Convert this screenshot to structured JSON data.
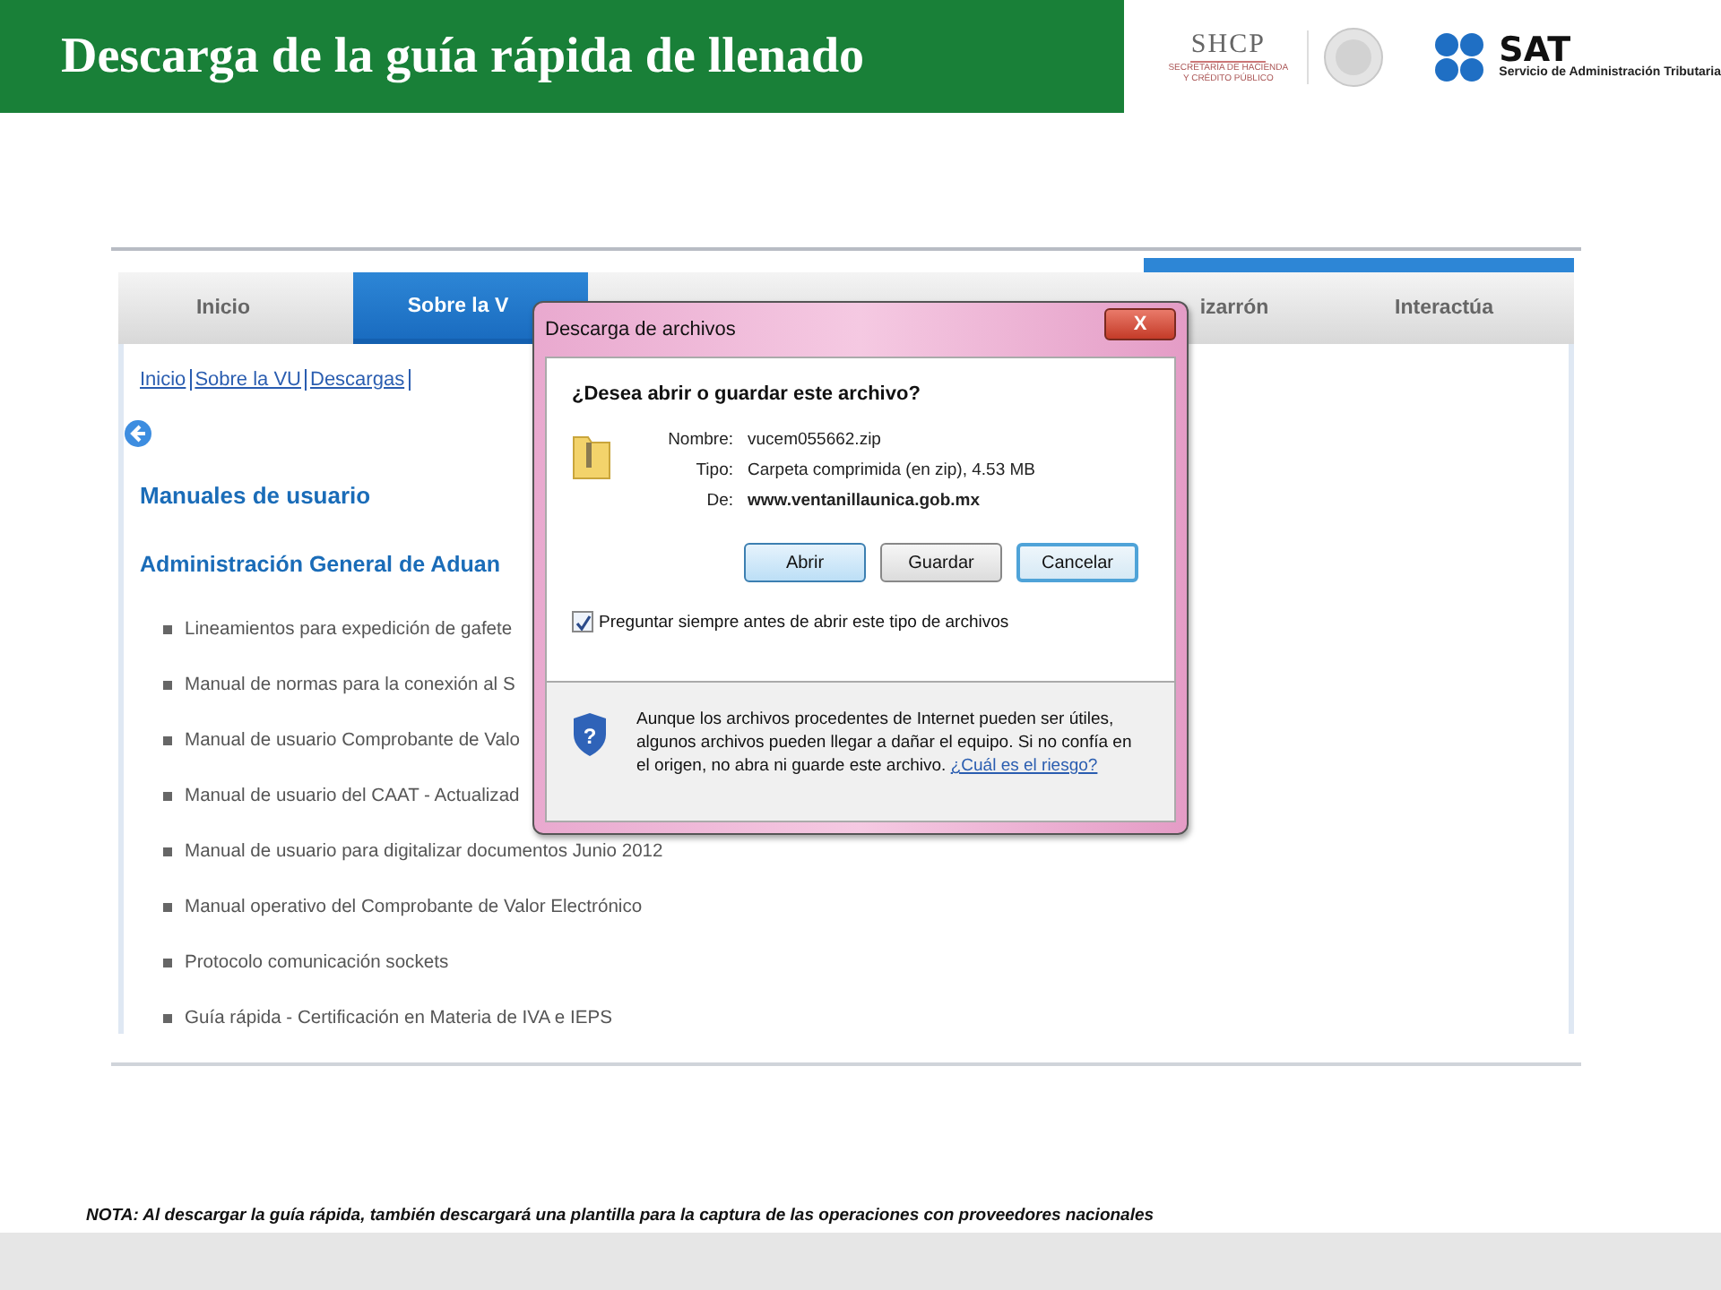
{
  "header": {
    "title": "Descarga de la guía rápida de llenado",
    "shcp": {
      "name": "SHCP",
      "subtitle": [
        "SECRETARÍA DE HACIENDA",
        "Y CRÉDITO PÚBLICO"
      ]
    },
    "sat": {
      "name": "SAT",
      "subtitle": "Servicio de Administración Tributaria"
    }
  },
  "screenshot": {
    "tabs": [
      {
        "label": "Inicio",
        "selected": false
      },
      {
        "label": "Sobre la V",
        "selected": true
      },
      {
        "selected": false
      },
      {
        "selected": false
      },
      {
        "label": "izarrón",
        "selected": false
      },
      {
        "label": "Interactúa",
        "selected": false
      }
    ],
    "breadcrumb": [
      "Inicio",
      "Sobre la VU",
      "Descargas"
    ],
    "heading": "Manuales de usuario",
    "subheading": "Administración General de Aduan",
    "items": [
      "Lineamientos para expedición de gafete",
      "Manual de normas para la conexión al S",
      "Manual de usuario Comprobante de Valo",
      "Manual de usuario del CAAT - Actualizad",
      "Manual de usuario para digitalizar documentos Junio 2012",
      "Manual operativo del Comprobante de Valor Electrónico",
      "Protocolo comunicación sockets",
      "Guía rápida - Certificación en Materia de  IVA e IEPS"
    ],
    "dialog": {
      "title": "Descarga de archivos",
      "close": "X",
      "shield_mark": "?",
      "question": "¿Desea abrir o guardar este archivo?",
      "fields": [
        {
          "label": "Nombre:",
          "value": "vucem055662.zip",
          "bold": false
        },
        {
          "label": "Tipo:",
          "value": "Carpeta comprimida (en zip), 4.53 MB",
          "bold": false
        },
        {
          "label": "De:",
          "value": "www.ventanillaunica.gob.mx",
          "bold": true
        }
      ],
      "buttons": [
        {
          "label": "Abrir",
          "kind": "default"
        },
        {
          "label": "Guardar",
          "kind": "normal"
        },
        {
          "label": "Cancelar",
          "kind": "focused"
        }
      ],
      "checkbox": {
        "label": "Preguntar siempre antes de abrir este tipo de archivos",
        "checked": true
      },
      "warning": "Aunque los archivos procedentes de Internet pueden ser útiles, algunos archivos pueden llegar a dañar el equipo. Si no confía en el origen, no abra ni guarde este archivo.",
      "link": "¿Cuál es el riesgo?"
    }
  },
  "note": "NOTA: Al descargar  la guía rápida, también descargará una plantilla para  la captura de las operaciones con proveedores nacionales"
}
